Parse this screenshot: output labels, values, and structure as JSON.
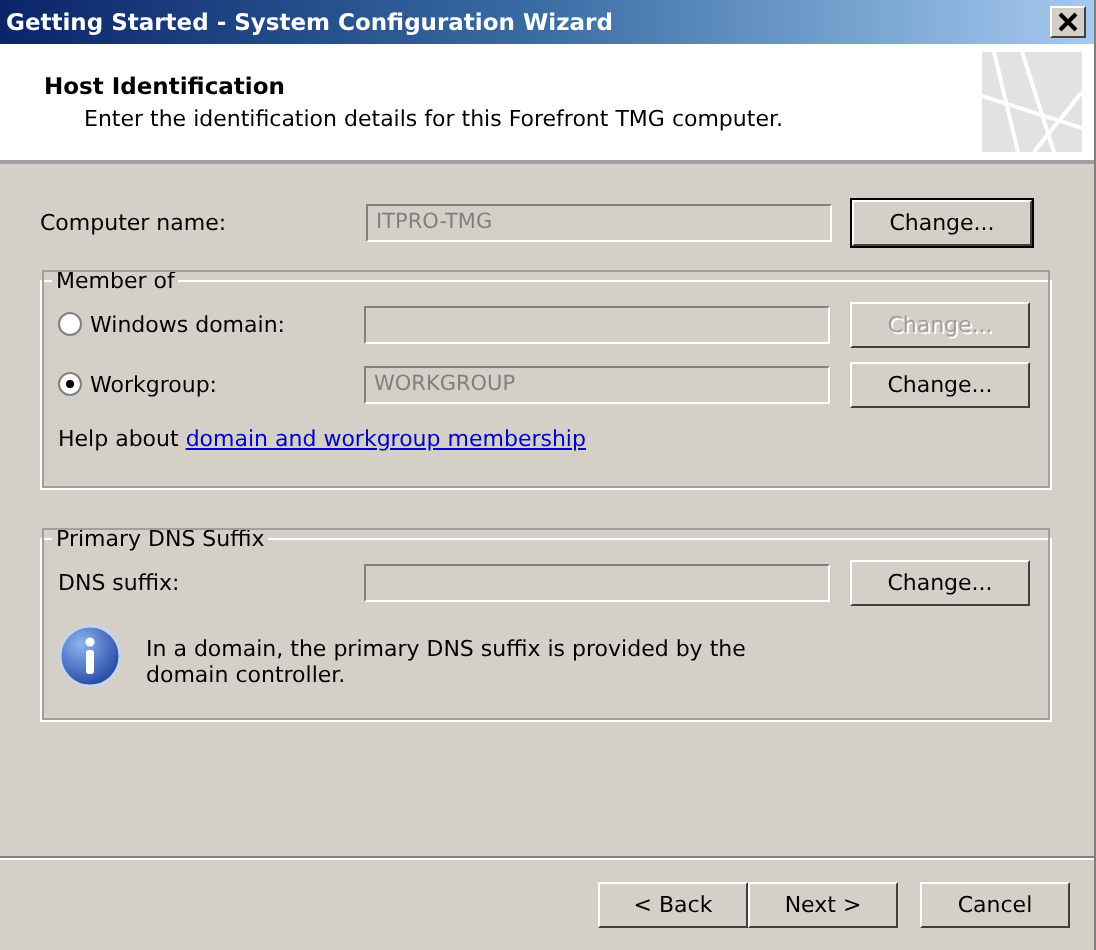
{
  "window": {
    "title": "Getting Started - System Configuration Wizard"
  },
  "header": {
    "title": "Host Identification",
    "subtitle": "Enter the identification details for this Forefront TMG computer."
  },
  "computer_name": {
    "label": "Computer name:",
    "value": "ITPRO-TMG",
    "button": {
      "label": "Change...",
      "disabled": false,
      "default": true
    }
  },
  "member_of": {
    "title": "Member of",
    "options": [
      {
        "label": "Windows domain:",
        "selected": false,
        "button": {
          "label": "Change...",
          "disabled": true,
          "default": false
        }
      },
      {
        "label": "Workgroup:",
        "selected": true,
        "value": "WORKGROUP",
        "button": {
          "label": "Change...",
          "disabled": false,
          "default": false
        }
      }
    ],
    "help_text": "Help about",
    "help_link": "domain and workgroup membership"
  },
  "dns": {
    "title": "Primary DNS Suffix",
    "label": "DNS suffix:",
    "button": {
      "label": "Change...",
      "disabled": false,
      "default": false
    },
    "info": "In a domain, the primary DNS suffix is provided by the domain controller."
  },
  "buttons": [
    {
      "label": "< Back",
      "disabled": false
    },
    {
      "label": "Next >",
      "disabled": false
    },
    {
      "label": "Cancel",
      "disabled": false
    }
  ]
}
